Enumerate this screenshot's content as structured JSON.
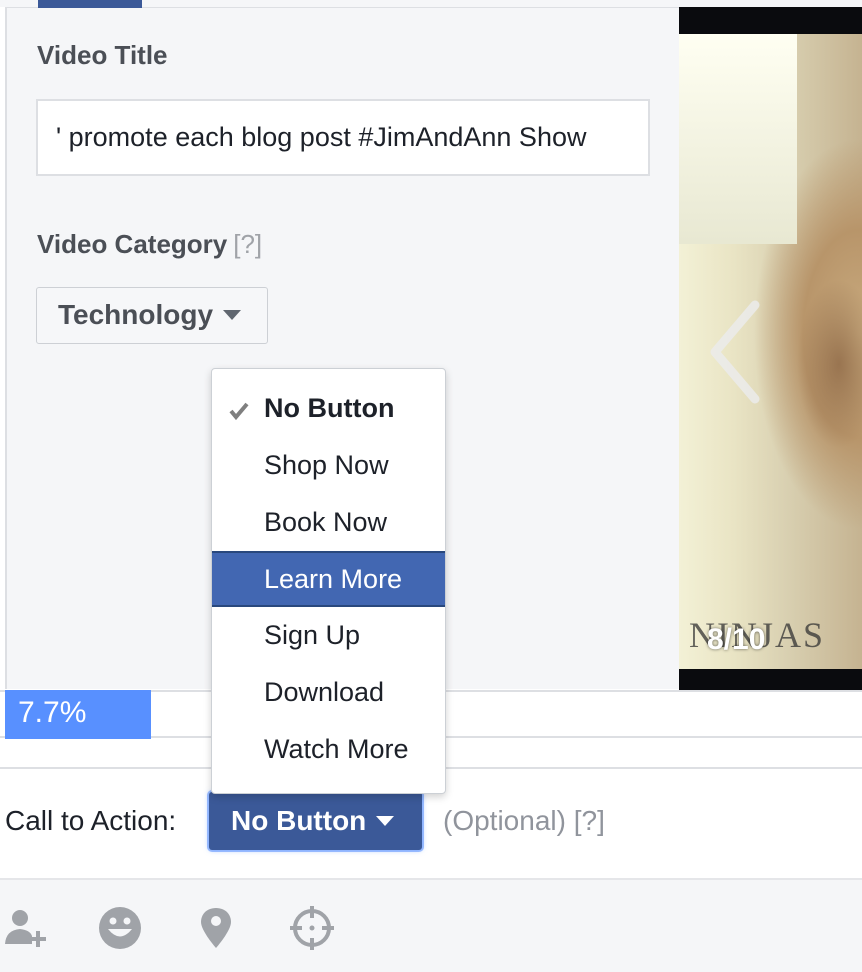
{
  "form": {
    "video_title_label": "Video Title",
    "video_title_value": "' promote each blog post #JimAndAnn Show",
    "video_category_label": "Video Category",
    "video_category_help": "[?]",
    "video_category_value": "Technology"
  },
  "video_preview": {
    "slide_counter": "8/10",
    "watermark_text": "NINJAS",
    "prev_icon": "chevron-left-icon"
  },
  "upload_progress": {
    "percent": 7.7,
    "label": "7.7%",
    "color": "#5890ff"
  },
  "call_to_action": {
    "label": "Call to Action:",
    "selected": "No Button",
    "optional_text": "(Optional) [?]",
    "button_color": "#3b5998",
    "menu": {
      "items": [
        {
          "label": "No Button",
          "checked": true,
          "highlighted": false
        },
        {
          "label": "Shop Now",
          "checked": false,
          "highlighted": false
        },
        {
          "label": "Book Now",
          "checked": false,
          "highlighted": false
        },
        {
          "label": "Learn More",
          "checked": false,
          "highlighted": true
        },
        {
          "label": "Sign Up",
          "checked": false,
          "highlighted": false
        },
        {
          "label": "Download",
          "checked": false,
          "highlighted": false
        },
        {
          "label": "Watch More",
          "checked": false,
          "highlighted": false
        }
      ],
      "highlight_color": "#4267b2"
    }
  },
  "toolbar": {
    "icons": [
      "tag-people-icon",
      "emoji-icon",
      "location-pin-icon",
      "target-icon"
    ]
  }
}
